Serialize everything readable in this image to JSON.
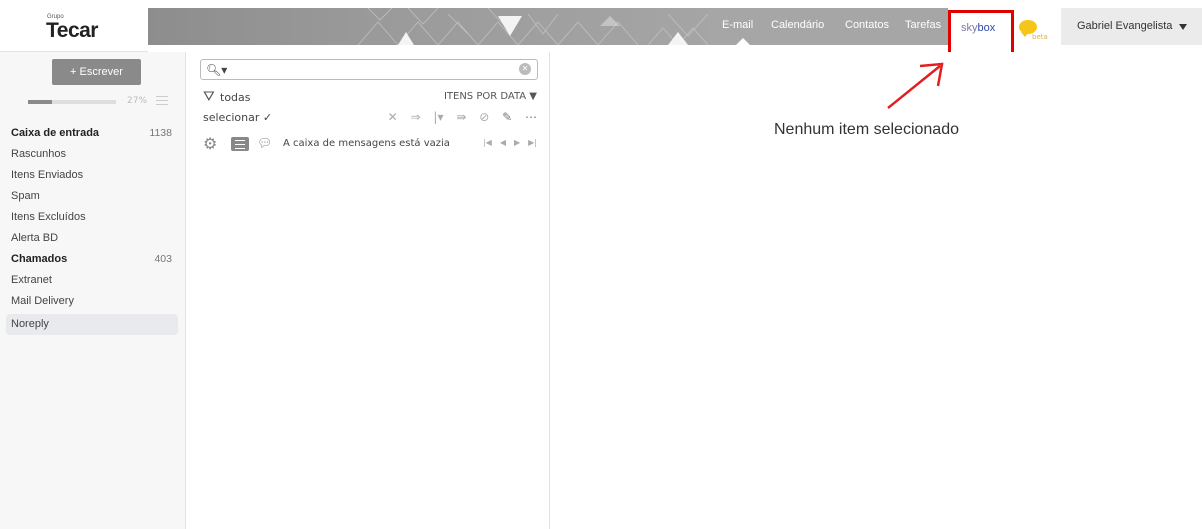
{
  "brand": {
    "small": "Grupo",
    "name": "Tecar"
  },
  "nav": {
    "email": "E-mail",
    "calendar": "Calendário",
    "contacts": "Contatos",
    "tasks": "Tarefas",
    "skybox_a": "sky",
    "skybox_b": "box",
    "beta": "beta",
    "user": "Gabriel Evangelista"
  },
  "sidebar": {
    "compose_label": "+ Escrever",
    "quota_percent": "27%",
    "quota_fraction": 0.27,
    "folders": [
      {
        "label": "Caixa de entrada",
        "count": "1138"
      },
      {
        "label": "Rascunhos",
        "count": ""
      },
      {
        "label": "Itens Enviados",
        "count": ""
      },
      {
        "label": "Spam",
        "count": ""
      },
      {
        "label": "Itens Excluídos",
        "count": ""
      },
      {
        "label": "Alerta BD",
        "count": ""
      },
      {
        "label": "Chamados",
        "count": "403"
      },
      {
        "label": "Extranet",
        "count": ""
      },
      {
        "label": "Mail Delivery",
        "count": ""
      },
      {
        "label": "Noreply",
        "count": ""
      }
    ]
  },
  "list": {
    "search_value": "",
    "filter_label": "todas",
    "sort_label": "ITENS POR DATA",
    "select_label": "selecionar ✓",
    "empty_text": "A caixa de mensagens está vazia"
  },
  "reading": {
    "no_item_text": "Nenhum item selecionado"
  },
  "colors": {
    "highlight_border": "#e00000",
    "arrow": "#e02020",
    "chat_bubble": "#f5c518"
  },
  "icons": [
    "search-icon",
    "clear-icon",
    "filter-icon",
    "gear-icon",
    "list-view-icon",
    "thread-icon",
    "chevron-down-icon",
    "chat-bubble-icon"
  ]
}
